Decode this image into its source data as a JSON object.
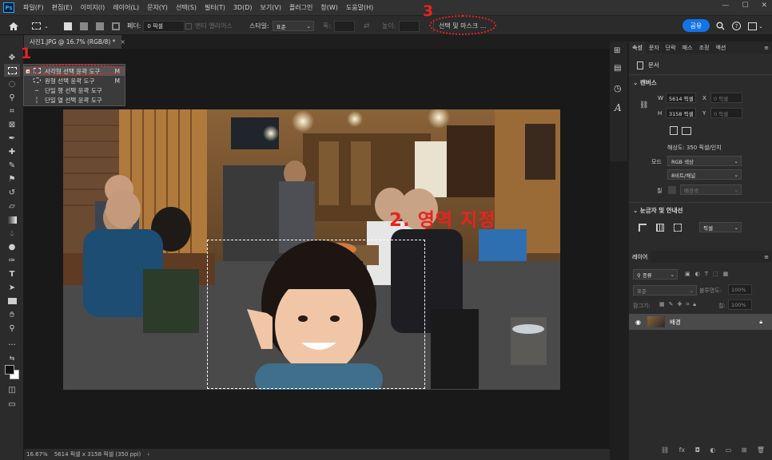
{
  "app": {
    "logo": "Ps"
  },
  "menu": [
    "파일(F)",
    "편집(E)",
    "이미지(I)",
    "레이어(L)",
    "문자(Y)",
    "선택(S)",
    "필터(T)",
    "3D(D)",
    "보기(V)",
    "플러그인",
    "창(W)",
    "도움말(H)"
  ],
  "window_controls": {
    "min": "—",
    "max": "☐",
    "close": "✕"
  },
  "options": {
    "feather_label": "페더:",
    "feather_value": "0 픽셀",
    "antialias_label": "앤티 앨리어스",
    "style_label": "스타일:",
    "style_value": "표준",
    "width_label": "폭:",
    "height_label": "높이:",
    "select_mask": "선택 및 마스크 ...",
    "share": "공유"
  },
  "document": {
    "tab_title": "사진1.JPG @ 16.7% (RGB/8) *",
    "tab_close": "×"
  },
  "status": {
    "zoom": "16.67%",
    "info": "5614 픽셀 x 3158 픽셀 (350 ppi)",
    "arrow": "›"
  },
  "flyout": {
    "items": [
      {
        "icon": "rect",
        "label": "사각형 선택 윤곽 도구",
        "key": "M"
      },
      {
        "icon": "ellipse",
        "label": "원형 선택 윤곽 도구",
        "key": "M"
      },
      {
        "icon": "row",
        "label": "단일 행 선택 윤곽 도구",
        "key": ""
      },
      {
        "icon": "col",
        "label": "단일 열 선택 윤곽 도구",
        "key": ""
      }
    ]
  },
  "annotations": {
    "n1": "1",
    "n2": "2. 영역 지정",
    "n3": "3"
  },
  "properties": {
    "tabs": [
      "속성",
      "문자",
      "단락",
      "패스",
      "조정",
      "액션"
    ],
    "doc_label": "문서",
    "canvas_section": "캔버스",
    "w_label": "W",
    "w_value": "5614 픽셀",
    "x_label": "X",
    "x_value": "0 픽셀",
    "h_label": "H",
    "h_value": "3158 픽셀",
    "y_label": "Y",
    "y_value": "0 픽셀",
    "resolution": "해상도: 350 픽셀/인치",
    "mode_label": "모드",
    "mode_value": "RGB 색상",
    "bits_value": "8비트/채널",
    "fill_label": "칠",
    "fill_value": "배경색",
    "rulers_section": "눈금자 및 안내선",
    "units_value": "픽셀"
  },
  "layers": {
    "tab": "레이어",
    "search": "종류",
    "blend": "표준",
    "opacity_label": "불투명도:",
    "opacity_value": "100%",
    "lock_label": "잠그기:",
    "fill_label": "칠:",
    "fill_value": "100%",
    "layer_name": "배경"
  },
  "colors": {
    "accent": "#1473e6",
    "annot": "#e8231f"
  }
}
